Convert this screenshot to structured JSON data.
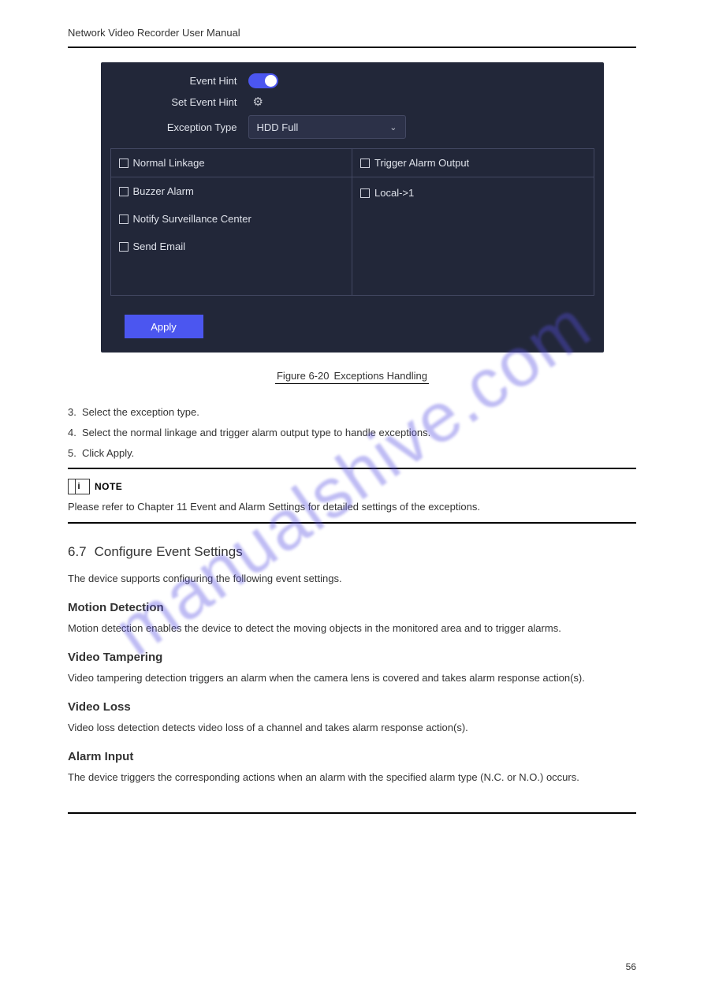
{
  "header": "Network Video Recorder User Manual",
  "screenshot": {
    "eventHint": {
      "label": "Event Hint"
    },
    "setEventHint": {
      "label": "Set Event Hint"
    },
    "exceptionType": {
      "label": "Exception Type",
      "value": "HDD Full"
    },
    "normalLinkage": "Normal Linkage",
    "triggerAlarmOutput": "Trigger Alarm Output",
    "opts": {
      "buzzer": "Buzzer Alarm",
      "notify": "Notify Surveillance Center",
      "sendEmail": "Send Email",
      "local1": "Local->1"
    },
    "apply": "Apply"
  },
  "caption": {
    "prefix": "Figure 6-20",
    "text": "Exceptions Handling"
  },
  "steps": {
    "s3": {
      "n": "3.",
      "t": "Select the exception type."
    },
    "s4": {
      "n": "4.",
      "t": "Select the normal linkage and trigger alarm output type to handle exceptions."
    },
    "s5": {
      "n": "5.",
      "t": "Click Apply."
    }
  },
  "note": {
    "word": "NOTE",
    "text": "Please refer to Chapter 11 Event and Alarm Settings for detailed settings of the exceptions."
  },
  "h3": {
    "num": "6.7",
    "title": "Configure Event Settings"
  },
  "p1": "The device supports configuring the following event settings.",
  "h4a": "Motion Detection",
  "p2": "Motion detection enables the device to detect the moving objects in the monitored area and to trigger alarms.",
  "h4b": "Video Tampering",
  "p3": "Video tampering detection triggers an alarm when the camera lens is covered and takes alarm response action(s).",
  "h4c": "Video Loss",
  "p4": "Video loss detection detects video loss of a channel and takes alarm response action(s).",
  "h4d": "Alarm Input",
  "p5": "The device triggers the corresponding actions when an alarm with the specified alarm type (N.C. or N.O.) occurs.",
  "footer": "56"
}
